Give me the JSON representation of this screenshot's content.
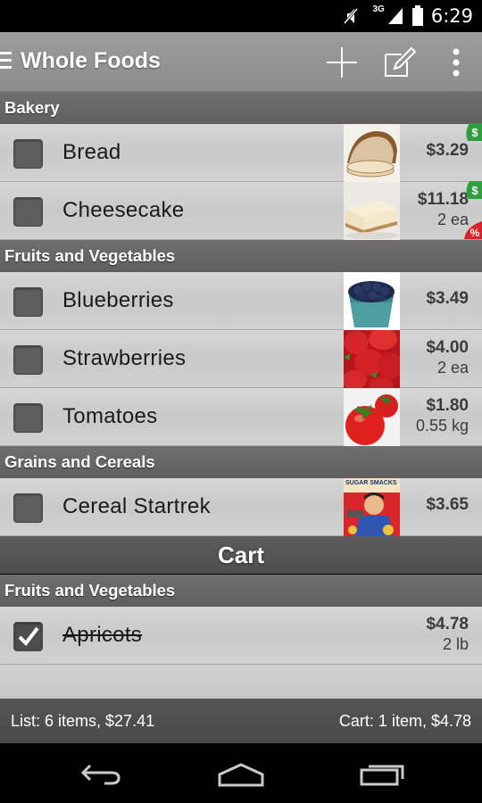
{
  "status_bar": {
    "time": "6:29",
    "network": "3G"
  },
  "action_bar": {
    "title": "Whole Foods"
  },
  "sections": [
    {
      "header": "Bakery"
    },
    {
      "header": "Fruits and Vegetables"
    },
    {
      "header": "Grains and Cereals"
    }
  ],
  "items": [
    {
      "name": "Bread",
      "price": "$3.29",
      "qty": ""
    },
    {
      "name": "Cheesecake",
      "price": "$11.18",
      "qty": "2 ea"
    },
    {
      "name": "Blueberries",
      "price": "$3.49",
      "qty": ""
    },
    {
      "name": "Strawberries",
      "price": "$4.00",
      "qty": "2 ea"
    },
    {
      "name": "Tomatoes",
      "price": "$1.80",
      "qty": "0.55 kg"
    },
    {
      "name": "Cereal Startrek",
      "price": "$3.65",
      "qty": ""
    }
  ],
  "cart": {
    "title": "Cart",
    "section_header": "Fruits and Vegetables",
    "items": [
      {
        "name": "Apricots",
        "price": "$4.78",
        "qty": "2 lb",
        "checked": true
      }
    ]
  },
  "footer": {
    "list_summary": "List: 6 items, $27.41",
    "cart_summary": "Cart: 1 item, $4.78"
  },
  "cereal_box_text": "SUGAR SMACKS",
  "colors": {
    "action_bar": "#959595",
    "section_header": "#676767",
    "row": "#cfcfcf",
    "badge_green": "#2e9e3e",
    "badge_red": "#d9232a"
  }
}
